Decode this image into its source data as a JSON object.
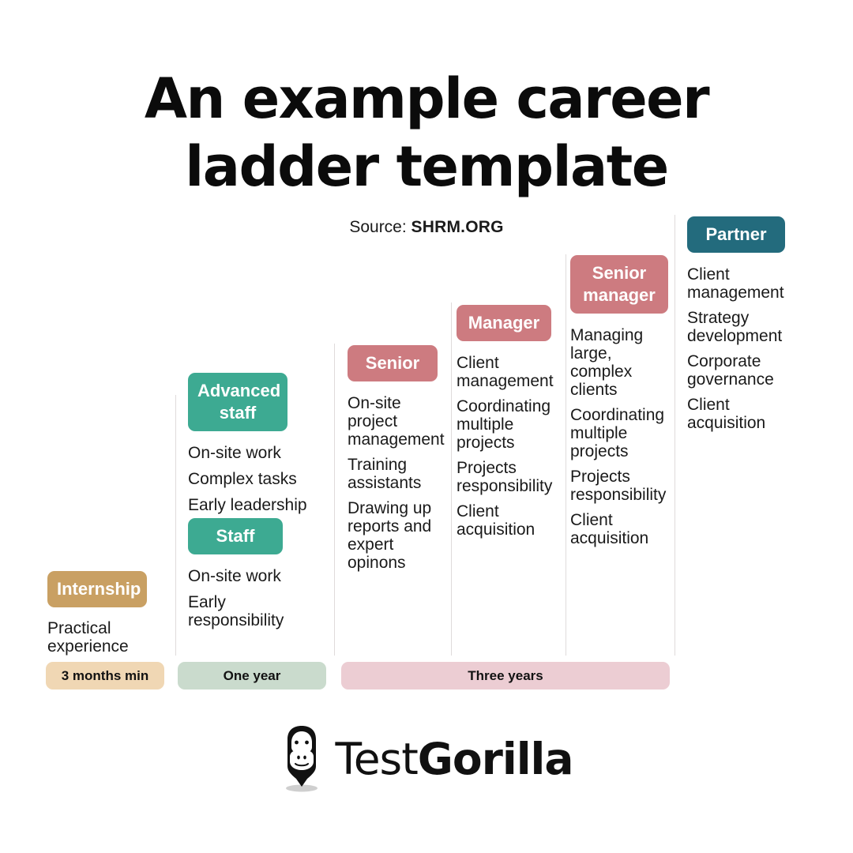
{
  "title": {
    "line1": "An example career",
    "line2": "ladder template"
  },
  "source": {
    "label": "Source:",
    "value": "SHRM.ORG"
  },
  "colors": {
    "gold_badge": "#c9a063",
    "teal_badge": "#3daa92",
    "rose_badge": "#cd7b80",
    "dark_teal_badge": "#236b7d",
    "timeline_gold": "#f0d7b4",
    "timeline_green": "#cadbcd",
    "timeline_rose": "#eccdd3",
    "divider": "#dfdbdb",
    "background": "#ffffff",
    "text": "#1a1a1a"
  },
  "stages": [
    {
      "id": "internship",
      "label": "Internship",
      "bullets": [
        "Practical experience"
      ]
    },
    {
      "id": "staff",
      "label": "Staff",
      "bullets": [
        "On-site work",
        "Early responsibility"
      ]
    },
    {
      "id": "advanced-staff",
      "label": "Advanced staff",
      "bullets": [
        "On-site work",
        "Complex tasks",
        "Early leadership"
      ]
    },
    {
      "id": "senior",
      "label": "Senior",
      "bullets": [
        "On-site project management",
        "Training assistants",
        "Drawing up reports and expert opinons"
      ]
    },
    {
      "id": "manager",
      "label": "Manager",
      "bullets": [
        "Client management",
        "Coordinating multiple projects",
        "Projects responsibility",
        "Client acquisition"
      ]
    },
    {
      "id": "senior-manager",
      "label": "Senior manager",
      "bullets": [
        "Managing large, complex clients",
        "Coordinating multiple projects",
        "Projects responsibility",
        "Client acquisition"
      ]
    },
    {
      "id": "partner",
      "label": "Partner",
      "bullets": [
        "Client management",
        "Strategy development",
        "Corporate governance",
        "Client acquisition"
      ]
    }
  ],
  "timeline": [
    {
      "id": "internship-duration",
      "label": "3 months min"
    },
    {
      "id": "staff-duration",
      "label": "One year"
    },
    {
      "id": "senior-plus-duration",
      "label": "Three years"
    }
  ],
  "logo": {
    "text_light": "Test",
    "text_bold": "Gorilla",
    "mark": "gorilla-pin-icon"
  }
}
